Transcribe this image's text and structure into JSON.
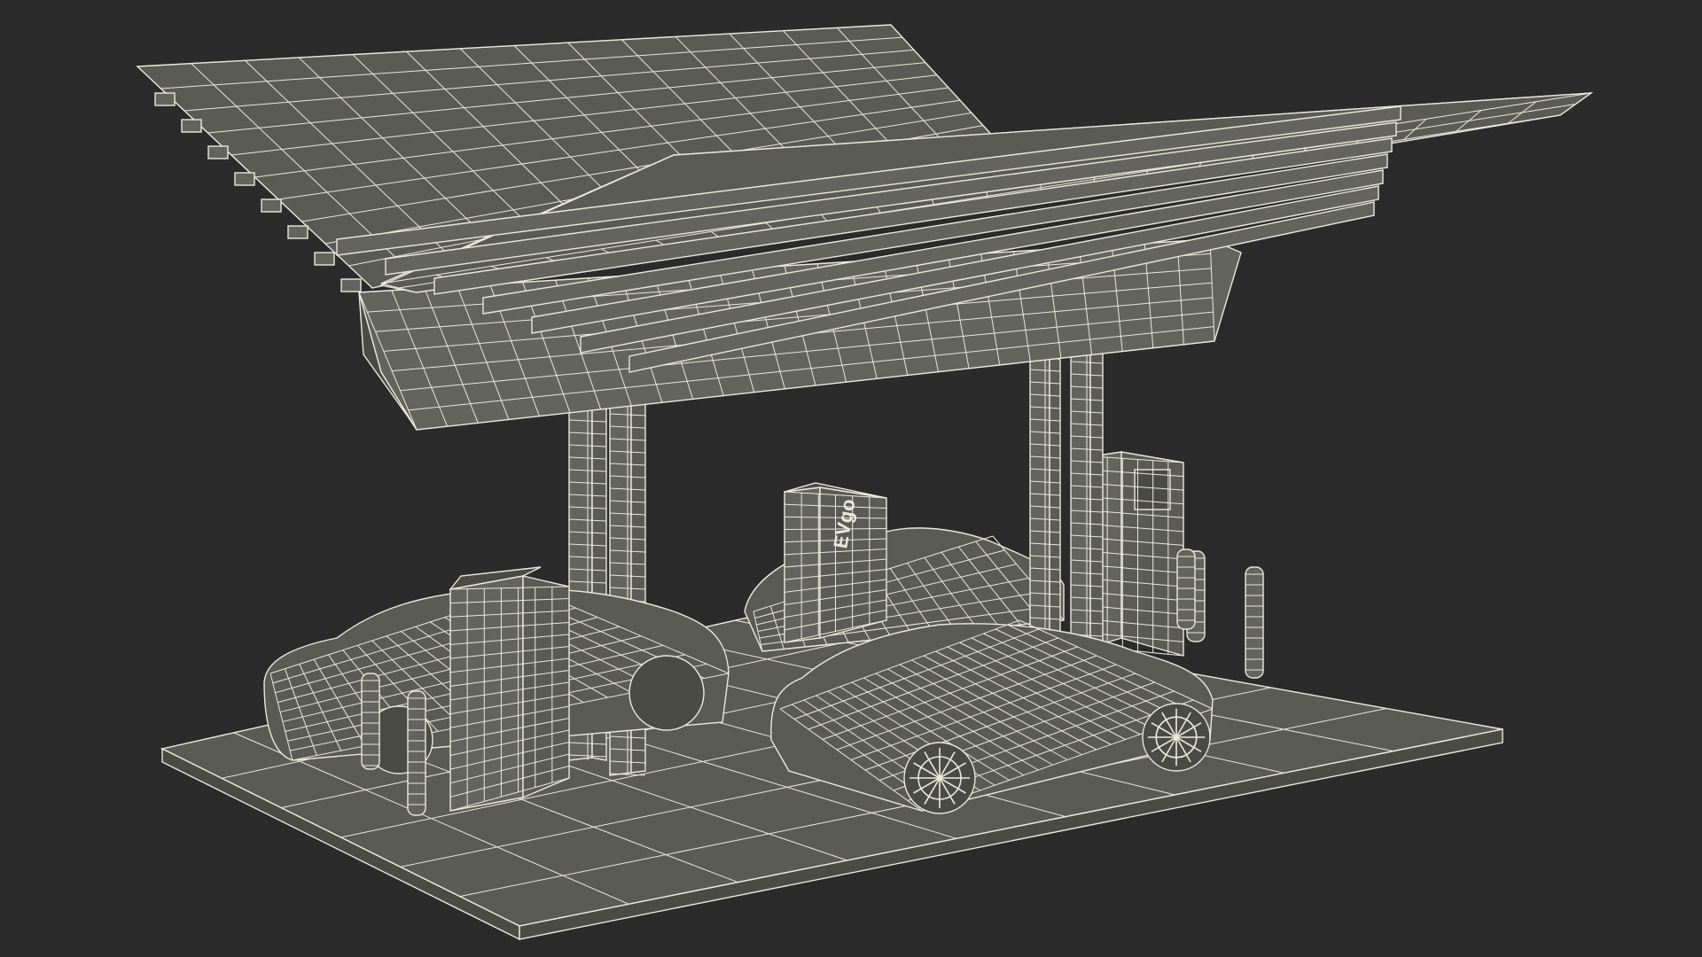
{
  "scene": {
    "subject": "wireframe-ev-charging-station",
    "background": "#2b2b2b",
    "wire_color": "#e9e9dc",
    "surface_color": "#5b5b55"
  },
  "charger": {
    "brand_text": "EVgo"
  },
  "objects": {
    "solar_panels": 2,
    "support_columns": 4,
    "chargers": 3,
    "cars": 3,
    "bollards": 6
  }
}
